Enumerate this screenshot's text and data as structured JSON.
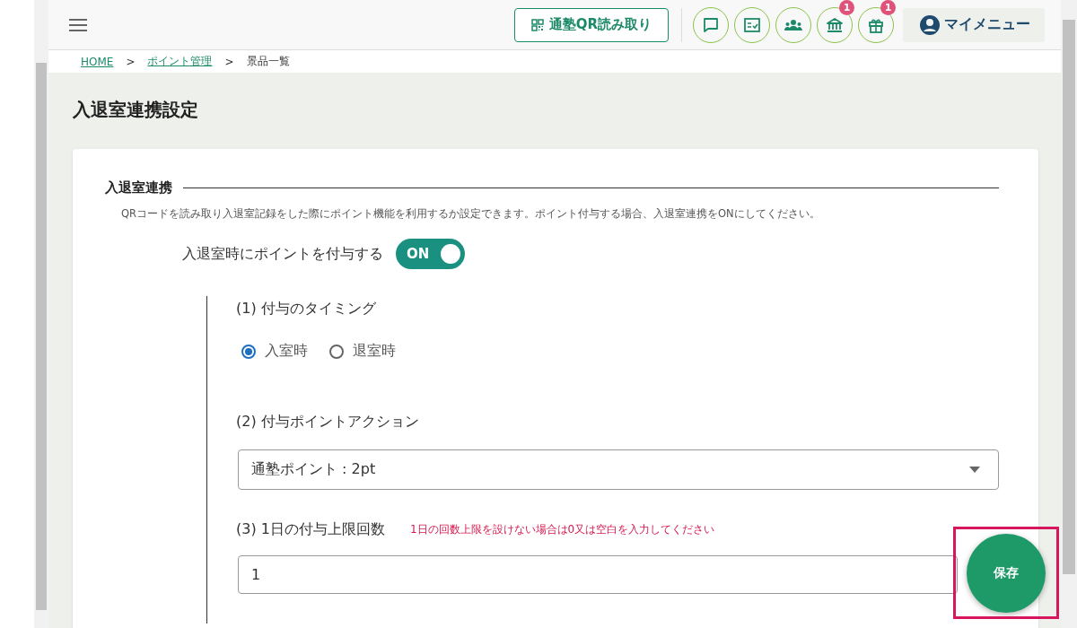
{
  "header": {
    "qr_button": "通塾QR読み取り",
    "icon_buttons": [
      {
        "kind": "chat"
      },
      {
        "kind": "checklist"
      },
      {
        "kind": "group"
      },
      {
        "kind": "bank",
        "badge": "1"
      },
      {
        "kind": "gift",
        "badge": "1"
      }
    ],
    "my_menu": "マイメニュー"
  },
  "breadcrumb": [
    {
      "label": "HOME",
      "link": true
    },
    {
      "label": ">",
      "link": false
    },
    {
      "label": "ポイント管理",
      "link": true
    },
    {
      "label": ">",
      "link": false
    },
    {
      "label": "景品一覧",
      "link": false
    }
  ],
  "page_title": "入退室連携設定",
  "section": {
    "title": "入退室連携",
    "description": "QRコードを読み取り入退室記録をした際にポイント機能を利用するか設定できます。ポイント付与する場合、入退室連携をONにしてください。",
    "toggle": {
      "label": "入退室時にポイントを付与する",
      "on": true,
      "text": "ON"
    },
    "timing": {
      "heading": "(1) 付与のタイミング",
      "options": [
        {
          "label": "入室時",
          "selected": true
        },
        {
          "label": "退室時",
          "selected": false
        }
      ]
    },
    "action": {
      "heading": "(2) 付与ポイントアクション",
      "value": "通塾ポイント : 2pt"
    },
    "limit": {
      "heading": "(3) 1日の付与上限回数",
      "note": "1日の回数上限を設けない場合は0又は空白を入力してください",
      "value": "1"
    }
  },
  "save_button": "保存"
}
